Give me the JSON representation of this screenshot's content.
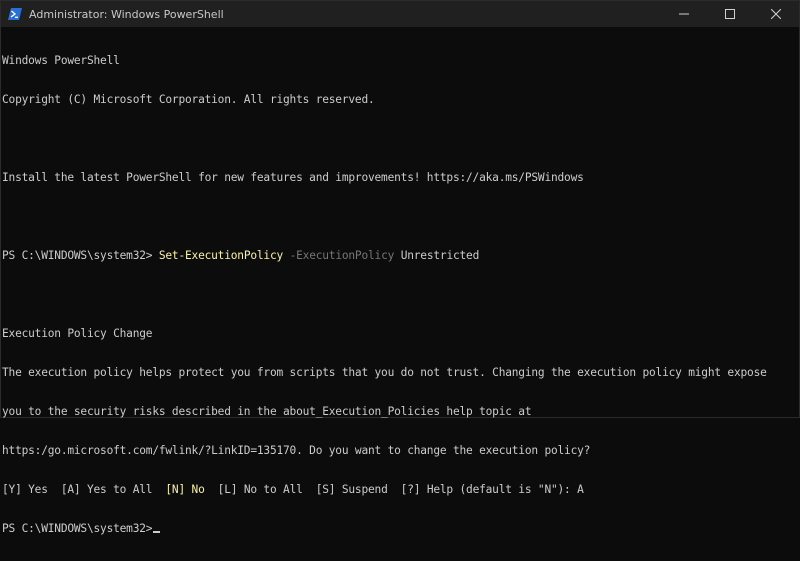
{
  "window": {
    "title": "Administrator: Windows PowerShell"
  },
  "icons": {
    "app": "powershell-icon",
    "minimize": "minimize-icon",
    "maximize": "maximize-icon",
    "close": "close-icon"
  },
  "colors": {
    "console_bg": "#0c0c0c",
    "titlebar_bg": "#202020",
    "text": "#cccccc",
    "command": "#f9f1a5",
    "parameter": "#767676",
    "powershell_blue": "#2a6fd6"
  },
  "console": {
    "line1": "Windows PowerShell",
    "line2": "Copyright (C) Microsoft Corporation. All rights reserved.",
    "line3": "",
    "line4": "Install the latest PowerShell for new features and improvements! https://aka.ms/PSWindows",
    "line5": "",
    "prompt1": "PS C:\\WINDOWS\\system32> ",
    "cmd_name": "Set-ExecutionPolicy",
    "cmd_param": " -ExecutionPolicy",
    "cmd_value": " Unrestricted",
    "line7": "",
    "heading": "Execution Policy Change",
    "msg1": "The execution policy helps protect you from scripts that you do not trust. Changing the execution policy might expose",
    "msg2": "you to the security risks described in the about_Execution_Policies help topic at",
    "msg3": "https:/go.microsoft.com/fwlink/?LinkID=135170. Do you want to change the execution policy?",
    "choice_pre": "[Y] Yes  [A] Yes to All  ",
    "choice_default": "[N] No",
    "choice_post": "  [L] No to All  [S] Suspend  [?] Help (default is \"N\"): A",
    "prompt2": "PS C:\\WINDOWS\\system32>"
  }
}
